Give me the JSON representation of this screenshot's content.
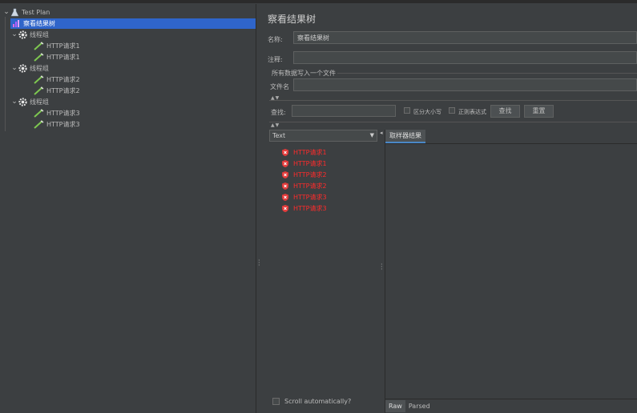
{
  "tree": {
    "items": [
      {
        "label": "Test Plan",
        "level": 0
      },
      {
        "label": "察看结果树",
        "level": 1,
        "selected": true
      },
      {
        "label": "线程组",
        "level": 1
      },
      {
        "label": "HTTP请求1",
        "level": 2
      },
      {
        "label": "HTTP请求1",
        "level": 2
      },
      {
        "label": "线程组",
        "level": 1
      },
      {
        "label": "HTTP请求2",
        "level": 2
      },
      {
        "label": "HTTP请求2",
        "level": 2
      },
      {
        "label": "线程组",
        "level": 1
      },
      {
        "label": "HTTP请求3",
        "level": 2
      },
      {
        "label": "HTTP请求3",
        "level": 2
      }
    ]
  },
  "panel": {
    "title": "察看结果树",
    "name_label": "名称:",
    "name_value": "察看结果树",
    "comment_label": "注释:",
    "comment_value": "",
    "file_section_label": "所有数据写入一个文件",
    "filename_label": "文件名",
    "filename_value": ""
  },
  "search": {
    "label": "查找:",
    "value": "",
    "case_label": "区分大小写",
    "regex_label": "正则表达式",
    "find_button": "查找",
    "reset_button": "重置"
  },
  "renderer": {
    "selected": "Text"
  },
  "results": [
    "HTTP请求1",
    "HTTP请求1",
    "HTTP请求2",
    "HTTP请求2",
    "HTTP请求3",
    "HTTP请求3"
  ],
  "detail": {
    "tab_label": "取样器结果",
    "bottom_tabs": [
      "Raw",
      "Parsed"
    ]
  },
  "scroll_label": "Scroll automatically?",
  "colors": {
    "background": "#3c3f41",
    "selection": "#2f65ca",
    "error_text": "#ff2b2b"
  }
}
